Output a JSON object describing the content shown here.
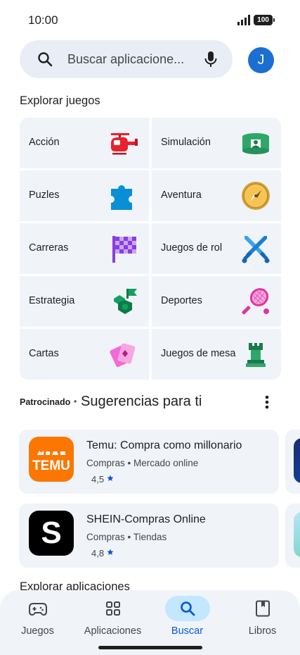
{
  "status": {
    "time": "10:00",
    "battery": "100"
  },
  "search": {
    "placeholder": "Buscar aplicacione..."
  },
  "avatar": {
    "initial": "J",
    "color": "#1b6fd1"
  },
  "explore_games": {
    "title": "Explorar juegos",
    "categories": [
      {
        "label": "Acción",
        "icon": "helicopter-icon"
      },
      {
        "label": "Simulación",
        "icon": "simulation-icon"
      },
      {
        "label": "Puzles",
        "icon": "puzzle-icon"
      },
      {
        "label": "Aventura",
        "icon": "compass-icon"
      },
      {
        "label": "Carreras",
        "icon": "checkered-flag-icon"
      },
      {
        "label": "Juegos de rol",
        "icon": "crossed-swords-icon"
      },
      {
        "label": "Estrategia",
        "icon": "strategy-flag-icon"
      },
      {
        "label": "Deportes",
        "icon": "tennis-racket-icon"
      },
      {
        "label": "Cartas",
        "icon": "cards-icon"
      },
      {
        "label": "Juegos de mesa",
        "icon": "chess-rook-icon"
      }
    ]
  },
  "suggestions": {
    "sponsored": "Patrocinado",
    "separator": "•",
    "title": "Sugerencias para ti",
    "apps": [
      {
        "name": "Temu: Compra como millonario",
        "category": "Compras",
        "subcategory": "Mercado online",
        "rating": "4,5",
        "icon": "temu-logo",
        "icon_text": "TEMU",
        "color": "#fb7701"
      },
      {
        "name": "SHEIN-Compras Online",
        "category": "Compras",
        "subcategory": "Tiendas",
        "rating": "4,8",
        "icon": "shein-logo",
        "icon_text": "S",
        "color": "#000000"
      }
    ]
  },
  "explore_apps": {
    "title": "Explorar aplicaciones"
  },
  "bottom_nav": {
    "items": [
      {
        "label": "Juegos",
        "icon": "gamepad-icon"
      },
      {
        "label": "Aplicaciones",
        "icon": "apps-grid-icon"
      },
      {
        "label": "Buscar",
        "icon": "search-icon",
        "active": true
      },
      {
        "label": "Libros",
        "icon": "book-icon"
      }
    ]
  },
  "colors": {
    "accent": "#0b57d0",
    "surface": "#f0f4f9",
    "active_pill": "#c2e7ff",
    "star": "#0b57d0"
  }
}
